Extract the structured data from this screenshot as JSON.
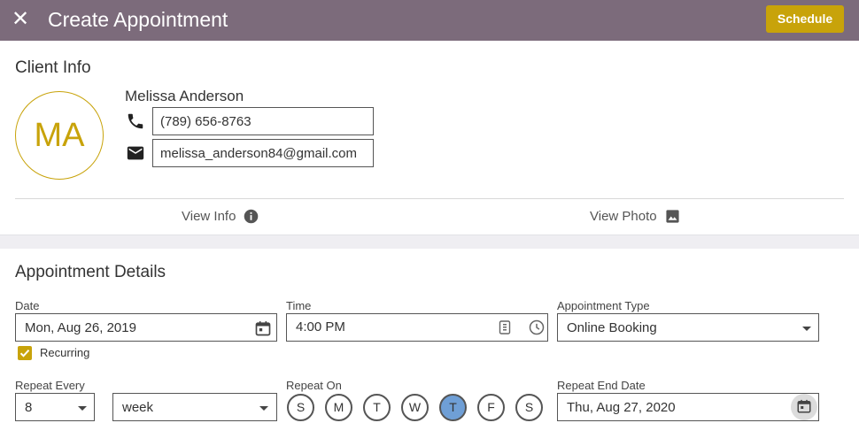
{
  "header": {
    "title": "Create Appointment",
    "close_icon": "✕",
    "schedule_label": "Schedule"
  },
  "client": {
    "section_title": "Client Info",
    "initials": "MA",
    "name": "Melissa Anderson",
    "phone": "(789) 656-8763",
    "email": "melissa_anderson84@gmail.com",
    "view_info_label": "View Info",
    "view_photo_label": "View Photo"
  },
  "details": {
    "section_title": "Appointment Details",
    "date_label": "Date",
    "date_value": "Mon, Aug 26, 2019",
    "time_label": "Time",
    "time_value": "4:00 PM",
    "type_label": "Appointment Type",
    "type_value": "Online Booking",
    "recurring_label": "Recurring",
    "recurring_checked": true,
    "repeat_every_label": "Repeat Every",
    "repeat_every_value": "8",
    "repeat_unit_value": "week",
    "repeat_on_label": "Repeat On",
    "days": [
      {
        "label": "S",
        "selected": false
      },
      {
        "label": "M",
        "selected": false
      },
      {
        "label": "T",
        "selected": false
      },
      {
        "label": "W",
        "selected": false
      },
      {
        "label": "T",
        "selected": true
      },
      {
        "label": "F",
        "selected": false
      },
      {
        "label": "S",
        "selected": false
      }
    ],
    "repeat_end_label": "Repeat End Date",
    "repeat_end_value": "Thu, Aug 27, 2020"
  },
  "colors": {
    "header_bg": "#7c6b7b",
    "accent": "#c8a30a",
    "selected_day": "#6f9fd6"
  }
}
